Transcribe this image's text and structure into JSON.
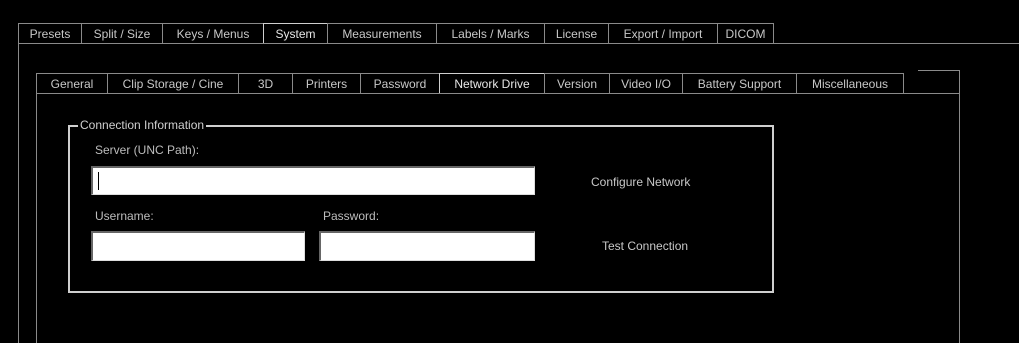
{
  "top_tabs": [
    {
      "label": "Presets",
      "active": false
    },
    {
      "label": "Split / Size",
      "active": false
    },
    {
      "label": "Keys / Menus",
      "active": false
    },
    {
      "label": "System",
      "active": true
    },
    {
      "label": "Measurements",
      "active": false
    },
    {
      "label": "Labels / Marks",
      "active": false
    },
    {
      "label": "License",
      "active": false
    },
    {
      "label": "Export / Import",
      "active": false
    },
    {
      "label": "DICOM",
      "active": false
    }
  ],
  "sub_tabs": [
    {
      "label": "General",
      "active": false
    },
    {
      "label": "Clip Storage / Cine",
      "active": false
    },
    {
      "label": "3D",
      "active": false
    },
    {
      "label": "Printers",
      "active": false
    },
    {
      "label": "Password",
      "active": false
    },
    {
      "label": "Network Drive",
      "active": true
    },
    {
      "label": "Version",
      "active": false
    },
    {
      "label": "Video I/O",
      "active": false
    },
    {
      "label": "Battery Support",
      "active": false
    },
    {
      "label": "Miscellaneous",
      "active": false
    }
  ],
  "connection": {
    "legend": "Connection Information",
    "server_label": "Server (UNC Path):",
    "server_value": "",
    "username_label": "Username:",
    "username_value": "",
    "password_label": "Password:",
    "password_value": "",
    "configure_label": "Configure Network",
    "test_label": "Test Connection"
  }
}
